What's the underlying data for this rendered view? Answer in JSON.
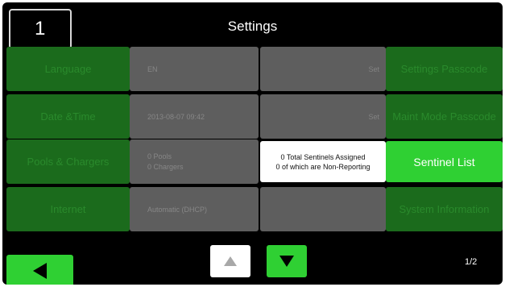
{
  "header": {
    "step_number": "1",
    "title": "Settings"
  },
  "rows": [
    {
      "label": "Language",
      "value_lines": [
        "EN"
      ],
      "action": "Set",
      "right_label": "Settings Passcode"
    },
    {
      "label": "Date &Time",
      "value_lines": [
        "2013-08-07  09:42"
      ],
      "action": "Set",
      "right_label": "Maint Mode Passcode"
    },
    {
      "label": "Pools & Chargers",
      "value_lines": [
        "0 Pools",
        "0 Chargers"
      ],
      "info_lines": [
        "0 Total Sentinels Assigned",
        "0 of which are Non-Reporting"
      ],
      "right_label": "Sentinel List"
    },
    {
      "label": "Internet",
      "value_lines": [
        "Automatic (DHCP)"
      ],
      "action": "",
      "right_label": "System Information"
    }
  ],
  "pagination": {
    "text": "1/2"
  },
  "colors": {
    "accent": "#2fd033",
    "dim_green": "#1b6b1c",
    "gray": "#5e5e5e"
  },
  "icons": {
    "back": "left-triangle",
    "up": "up-triangle",
    "down": "down-triangle"
  }
}
